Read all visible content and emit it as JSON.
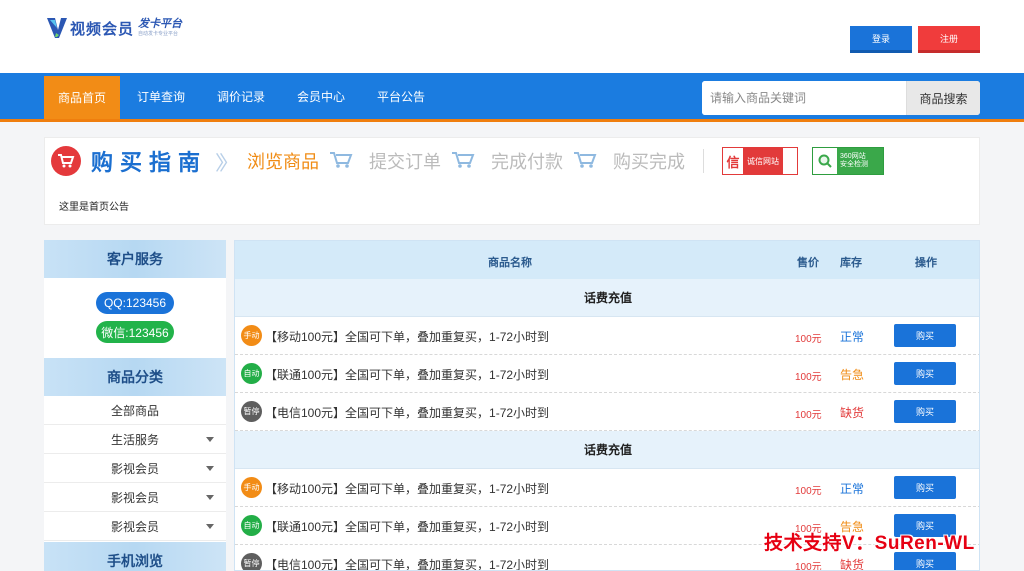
{
  "header": {
    "logo_text": "视频会员",
    "logo_sub": "发卡平台",
    "logo_tiny": "自动发卡专业平台",
    "login_label": "登录",
    "register_label": "注册"
  },
  "nav": {
    "items": [
      "商品首页",
      "订单查询",
      "调价记录",
      "会员中心",
      "平台公告"
    ],
    "active_index": 0,
    "search_placeholder": "请输入商品关键词",
    "search_button": "商品搜索"
  },
  "guide": {
    "title": "购买指南",
    "steps": [
      "浏览商品",
      "提交订单",
      "完成付款",
      "购买完成"
    ],
    "trust_badge_1": "诚信网站",
    "trust_badge_1_glyph": "信",
    "trust_badge_2_line1": "360网站",
    "trust_badge_2_line2": "安全检测",
    "notice": "这里是首页公告"
  },
  "sidebar": {
    "service_title": "客户服务",
    "qq": "QQ:123456",
    "wechat": "微信:123456",
    "category_title": "商品分类",
    "categories": [
      {
        "label": "全部商品",
        "has_caret": false
      },
      {
        "label": "生活服务",
        "has_caret": true
      },
      {
        "label": "影视会员",
        "has_caret": true
      },
      {
        "label": "影视会员",
        "has_caret": true
      },
      {
        "label": "影视会员",
        "has_caret": true
      }
    ],
    "mobile_title": "手机浏览"
  },
  "products": {
    "columns": [
      "商品名称",
      "售价",
      "库存",
      "操作"
    ],
    "groups": [
      {
        "title": "话费充值",
        "rows": [
          {
            "badge": "手动",
            "badge_color": "#f28c16",
            "name": "【移动100元】全国可下单，叠加重复买，1-72小时到",
            "price": "100元",
            "stock": "正常",
            "stock_color": "#1a73d9",
            "action": "购买"
          },
          {
            "badge": "自动",
            "badge_color": "#23ae47",
            "name": "【联通100元】全国可下单，叠加重复买，1-72小时到",
            "price": "100元",
            "stock": "告急",
            "stock_color": "#f08c15",
            "action": "购买"
          },
          {
            "badge": "暂停",
            "badge_color": "#5e5e5e",
            "name": "【电信100元】全国可下单，叠加重复买，1-72小时到",
            "price": "100元",
            "stock": "缺货",
            "stock_color": "#e23a3a",
            "action": "购买"
          }
        ]
      },
      {
        "title": "话费充值",
        "rows": [
          {
            "badge": "手动",
            "badge_color": "#f28c16",
            "name": "【移动100元】全国可下单，叠加重复买，1-72小时到",
            "price": "100元",
            "stock": "正常",
            "stock_color": "#1a73d9",
            "action": "购买"
          },
          {
            "badge": "自动",
            "badge_color": "#23ae47",
            "name": "【联通100元】全国可下单，叠加重复买，1-72小时到",
            "price": "100元",
            "stock": "告急",
            "stock_color": "#f08c15",
            "action": "购买"
          },
          {
            "badge": "暂停",
            "badge_color": "#5e5e5e",
            "name": "【电信100元】全国可下单，叠加重复买，1-72小时到",
            "price": "100元",
            "stock": "缺货",
            "stock_color": "#e23a3a",
            "action": "购买"
          }
        ]
      }
    ]
  },
  "watermark": "技术支持V：SuRen-WL",
  "colors": {
    "primary_blue": "#1b7ce0",
    "accent_orange": "#f28c16",
    "register_red": "#f03c3c",
    "wechat_green": "#22b34a"
  }
}
